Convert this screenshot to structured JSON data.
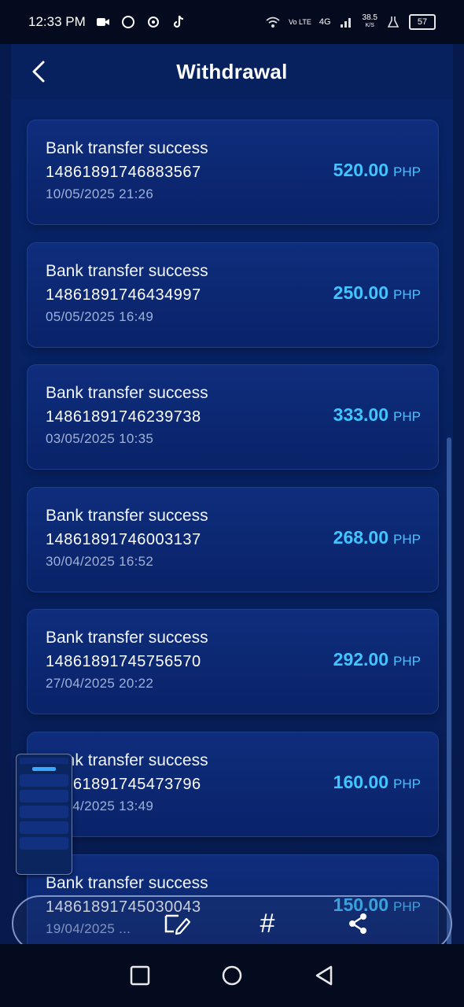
{
  "status_bar": {
    "time": "12:33 PM",
    "speed": "38.5",
    "speed_unit": "K/S",
    "network": "4G",
    "volte": "Vo LTE",
    "battery": "57"
  },
  "header": {
    "title": "Withdrawal"
  },
  "transactions": [
    {
      "status": "Bank transfer success",
      "ref": "14861891746883567",
      "date": "10/05/2025 21:26",
      "amount": "520.00",
      "currency": "PHP"
    },
    {
      "status": "Bank transfer success",
      "ref": "14861891746434997",
      "date": "05/05/2025 16:49",
      "amount": "250.00",
      "currency": "PHP"
    },
    {
      "status": "Bank transfer success",
      "ref": "14861891746239738",
      "date": "03/05/2025 10:35",
      "amount": "333.00",
      "currency": "PHP"
    },
    {
      "status": "Bank transfer success",
      "ref": "14861891746003137",
      "date": "30/04/2025 16:52",
      "amount": "268.00",
      "currency": "PHP"
    },
    {
      "status": "Bank transfer success",
      "ref": "14861891745756570",
      "date": "27/04/2025 20:22",
      "amount": "292.00",
      "currency": "PHP"
    },
    {
      "status": "Bank transfer success",
      "ref": "14861891745473796",
      "date": "24/04/2025 13:49",
      "amount": "160.00",
      "currency": "PHP"
    },
    {
      "status": "Bank transfer success",
      "ref": "14861891745030043",
      "date": "19/04/2025 ...",
      "amount": "150.00",
      "currency": "PHP"
    }
  ],
  "share_toolbar": {
    "hash_label": "#"
  },
  "colors": {
    "accent": "#41c5ff",
    "background": "#071a4d",
    "card": "#0e2d7c"
  }
}
